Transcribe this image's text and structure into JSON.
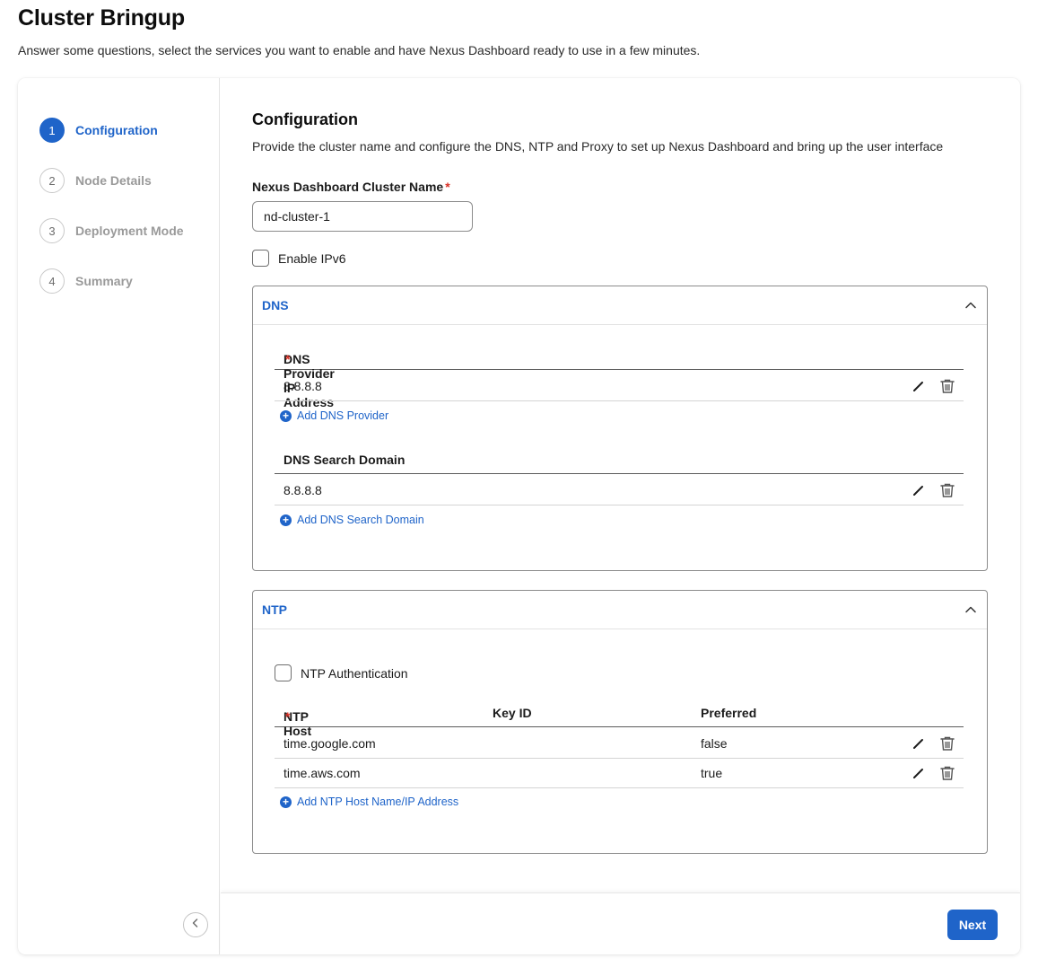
{
  "page": {
    "title": "Cluster Bringup",
    "subtitle": "Answer some questions, select the services you want to enable and have Nexus Dashboard ready to use in a few minutes."
  },
  "steps": [
    {
      "number": "1",
      "label": "Configuration",
      "active": true
    },
    {
      "number": "2",
      "label": "Node Details",
      "active": false
    },
    {
      "number": "3",
      "label": "Deployment Mode",
      "active": false
    },
    {
      "number": "4",
      "label": "Summary",
      "active": false
    }
  ],
  "config": {
    "title": "Configuration",
    "description": "Provide the cluster name and configure the DNS, NTP and Proxy to set up Nexus Dashboard and bring up the user interface",
    "cluster_name_label": "Nexus Dashboard Cluster Name",
    "required_mark": "*",
    "cluster_name_value": "nd-cluster-1",
    "enable_ipv6_label": "Enable IPv6",
    "enable_ipv6_checked": false
  },
  "dns": {
    "title": "DNS",
    "provider_header": "DNS Provider IP Address",
    "providers": [
      "8.8.8.8"
    ],
    "add_provider_label": "Add DNS Provider",
    "search_domain_header": "DNS Search Domain",
    "search_domains": [
      "8.8.8.8"
    ],
    "add_search_domain_label": "Add DNS Search Domain"
  },
  "ntp": {
    "title": "NTP",
    "auth_label": "NTP Authentication",
    "auth_checked": false,
    "columns": {
      "host": "NTP Host",
      "key_id": "Key ID",
      "preferred": "Preferred"
    },
    "rows": [
      {
        "host": "time.google.com",
        "key_id": "",
        "preferred": "false"
      },
      {
        "host": "time.aws.com",
        "key_id": "",
        "preferred": "true"
      }
    ],
    "add_host_label": "Add NTP Host Name/IP Address"
  },
  "footer": {
    "next_label": "Next"
  },
  "icons": {
    "edit": "pencil-icon",
    "delete": "trash-icon",
    "add": "plus-circle-icon",
    "collapse_panel": "chevron-up-icon",
    "collapse_sidebar": "chevron-left-icon"
  },
  "colors": {
    "accent": "#1f64c9",
    "required": "#d93025"
  }
}
